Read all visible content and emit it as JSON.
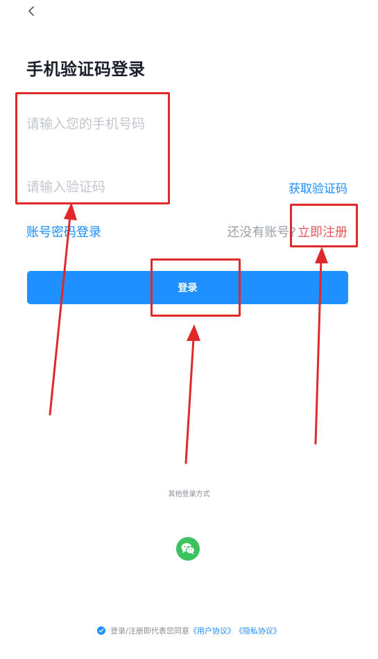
{
  "header": {
    "back_icon": "chevron-left-icon",
    "title": "手机验证码登录"
  },
  "form": {
    "phone_placeholder": "请输入您的手机号码",
    "phone_value": "",
    "code_placeholder": "请输入验证码",
    "code_value": "",
    "get_code_label": "获取验证码"
  },
  "links": {
    "password_login": "账号密码登录",
    "no_account_text": "还没有账号?",
    "register_label": "立即注册"
  },
  "login_button": {
    "label": "登录"
  },
  "other_login": {
    "label": "其他登录方式",
    "wechat_icon": "wechat-icon"
  },
  "agreement": {
    "checked": true,
    "text": "登录/注册即代表您同意",
    "user_agreement": "《用户协议》",
    "privacy_agreement": "《隐私协议》"
  },
  "colors": {
    "accent": "#1e90ff",
    "link": "#1a8cff",
    "register": "#e8535a",
    "wechat": "#3cc35f",
    "annotation": "#e0282b"
  }
}
